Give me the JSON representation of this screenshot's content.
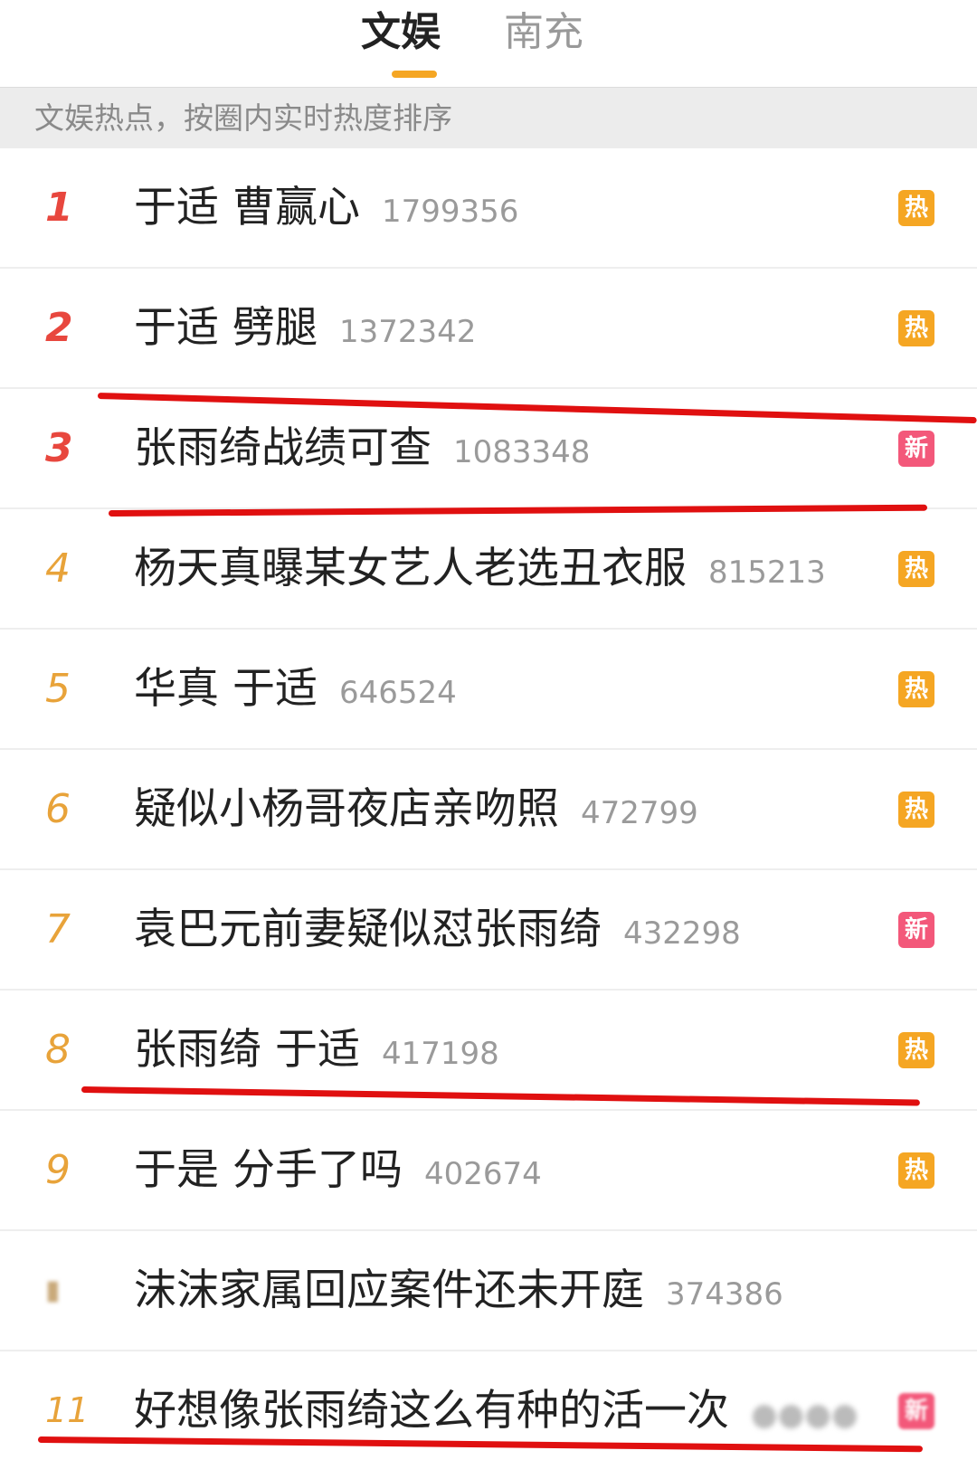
{
  "tabs": [
    {
      "label": "文娱",
      "active": true
    },
    {
      "label": "南充",
      "active": false
    }
  ],
  "subheader": "文娱热点，按圈内实时热度排序",
  "colors": {
    "accent": "#f5a623",
    "hot_badge": "#f5a623",
    "new_badge": "#f3587a",
    "top_rank": "#e8473e",
    "rank": "#e8a33a",
    "annotation_line": "#e01010"
  },
  "items": [
    {
      "rank": "1",
      "title": "于适 曹赢心",
      "count": "1799356",
      "badge": "热"
    },
    {
      "rank": "2",
      "title": "于适 劈腿",
      "count": "1372342",
      "badge": "热"
    },
    {
      "rank": "3",
      "title": "张雨绮战绩可查",
      "count": "1083348",
      "badge": "新"
    },
    {
      "rank": "4",
      "title": "杨天真曝某女艺人老选丑衣服",
      "count": "815213",
      "badge": "热"
    },
    {
      "rank": "5",
      "title": "华真 于适",
      "count": "646524",
      "badge": "热"
    },
    {
      "rank": "6",
      "title": "疑似小杨哥夜店亲吻照",
      "count": "472799",
      "badge": "热"
    },
    {
      "rank": "7",
      "title": "袁巴元前妻疑似怼张雨绮",
      "count": "432298",
      "badge": "新"
    },
    {
      "rank": "8",
      "title": "张雨绮 于适",
      "count": "417198",
      "badge": "热"
    },
    {
      "rank": "9",
      "title": "于是 分手了吗",
      "count": "402674",
      "badge": "热"
    },
    {
      "rank": "",
      "title": "沫沫家属回应案件还未开庭",
      "count": "374386",
      "badge": ""
    },
    {
      "rank": "11",
      "title": "好想像张雨绮这么有种的活一次",
      "count": "",
      "badge": "新"
    }
  ]
}
